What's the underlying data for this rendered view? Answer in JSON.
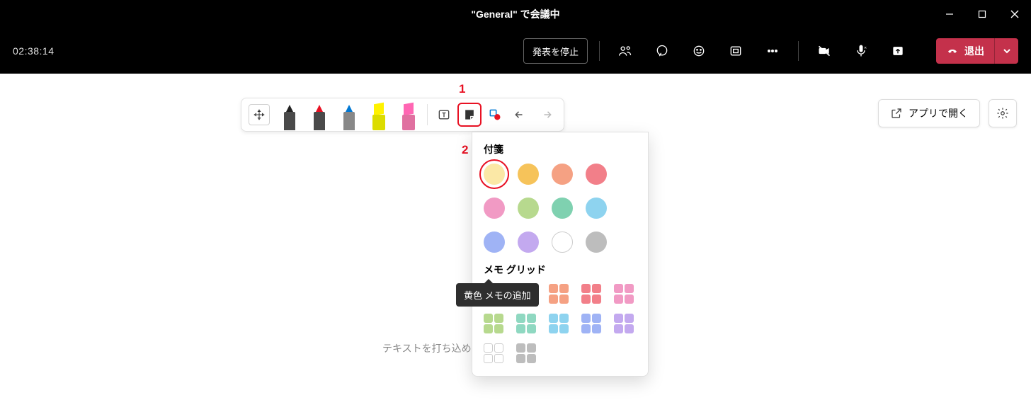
{
  "titlebar": {
    "title": "\"General\" で会議中"
  },
  "toolbar": {
    "timer": "02:38:14",
    "stop_present": "発表を停止",
    "leave_label": "退出"
  },
  "annotations": {
    "one": "1",
    "two": "2"
  },
  "popup": {
    "sticky_title": "付箋",
    "grid_title": "メモ グリッド",
    "tooltip": "黄色 メモの追加",
    "swatches": [
      {
        "color": "#fbe8a6",
        "name": "yellow",
        "selected": true
      },
      {
        "color": "#f6c35a",
        "name": "orange"
      },
      {
        "color": "#f5a183",
        "name": "coral"
      },
      {
        "color": "#f27f89",
        "name": "red"
      },
      {
        "color": "#f19ac4",
        "name": "pink"
      },
      {
        "color": "#b7d98e",
        "name": "green"
      },
      {
        "color": "#7fd1b0",
        "name": "teal"
      },
      {
        "color": "#8ed3ef",
        "name": "lightblue"
      },
      {
        "color": "#9fb3f5",
        "name": "blue"
      },
      {
        "color": "#c3a9ef",
        "name": "purple"
      },
      {
        "color": "#ffffff",
        "name": "white",
        "border": true
      },
      {
        "color": "#bdbdbd",
        "name": "gray"
      }
    ],
    "grid_swatches": [
      "#f6d37a",
      "#f6c35a",
      "#f5a183",
      "#f27f89",
      "#f19ac4",
      "#b7d98e",
      "#8fd8c1",
      "#8ed3ef",
      "#9fb3f5",
      "#c3a9ef",
      "#ffffff",
      "#bdbdbd"
    ]
  },
  "canvas": {
    "placeholder": "テキストを打ち込め"
  },
  "right": {
    "open_in_app": "アプリで開く"
  }
}
